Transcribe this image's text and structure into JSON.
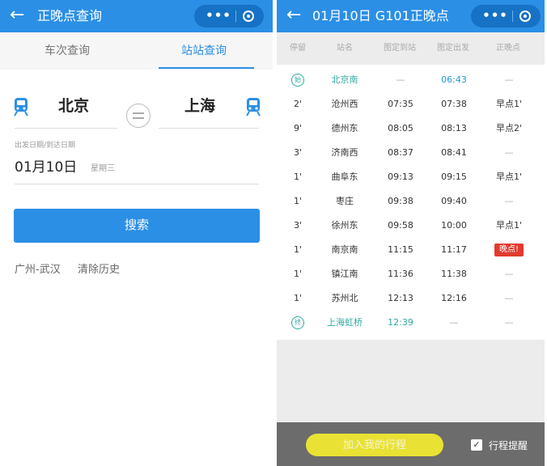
{
  "left": {
    "title": "正晚点查询",
    "tabs": [
      "车次查询",
      "站站查询"
    ],
    "from_station": "北京",
    "to_station": "上海",
    "date_label": "出发日期/到达日期",
    "date": "01月10日",
    "weekday": "星期三",
    "search_label": "搜索",
    "history": [
      "广州-武汉",
      "清除历史"
    ]
  },
  "right": {
    "title": "01月10日 G101正晚点",
    "columns": [
      "停留",
      "站名",
      "图定到站",
      "图定出发",
      "正晚点"
    ],
    "rows": [
      {
        "stop": "始",
        "station": "北京南",
        "arrive": "—",
        "depart": "06:43",
        "status": "—"
      },
      {
        "stop": "2'",
        "station": "沧州西",
        "arrive": "07:35",
        "depart": "07:38",
        "status": "早点1'"
      },
      {
        "stop": "9'",
        "station": "德州东",
        "arrive": "08:05",
        "depart": "08:13",
        "status": "早点2'"
      },
      {
        "stop": "3'",
        "station": "济南西",
        "arrive": "08:37",
        "depart": "08:41",
        "status": "—"
      },
      {
        "stop": "1'",
        "station": "曲阜东",
        "arrive": "09:13",
        "depart": "09:15",
        "status": "早点1'"
      },
      {
        "stop": "1'",
        "station": "枣庄",
        "arrive": "09:38",
        "depart": "09:40",
        "status": "—"
      },
      {
        "stop": "3'",
        "station": "徐州东",
        "arrive": "09:58",
        "depart": "10:00",
        "status": "早点1'"
      },
      {
        "stop": "1'",
        "station": "南京南",
        "arrive": "11:15",
        "depart": "11:17",
        "status": "晚点!"
      },
      {
        "stop": "1'",
        "station": "镇江南",
        "arrive": "11:36",
        "depart": "11:38",
        "status": "—"
      },
      {
        "stop": "1'",
        "station": "苏州北",
        "arrive": "12:13",
        "depart": "12:16",
        "status": "—"
      },
      {
        "stop": "终",
        "station": "上海虹桥",
        "arrive": "12:39",
        "depart": "—",
        "status": "—"
      }
    ],
    "add_trip_label": "加入我的行程",
    "checkbox_mark": "✓",
    "remind_label": "行程提醒"
  },
  "icons": {
    "back": "arrow-left-icon",
    "more": "more-dots-icon",
    "close": "target-circle-icon",
    "train": "train-icon",
    "swap": "swap-icon"
  },
  "colors": {
    "primary": "#2b8fe6",
    "capsule": "#1672c4",
    "teal": "#2fa9a0",
    "late": "#e23a2e",
    "bottom_bar": "#6c6c6c",
    "add_button": "#e9e234"
  }
}
